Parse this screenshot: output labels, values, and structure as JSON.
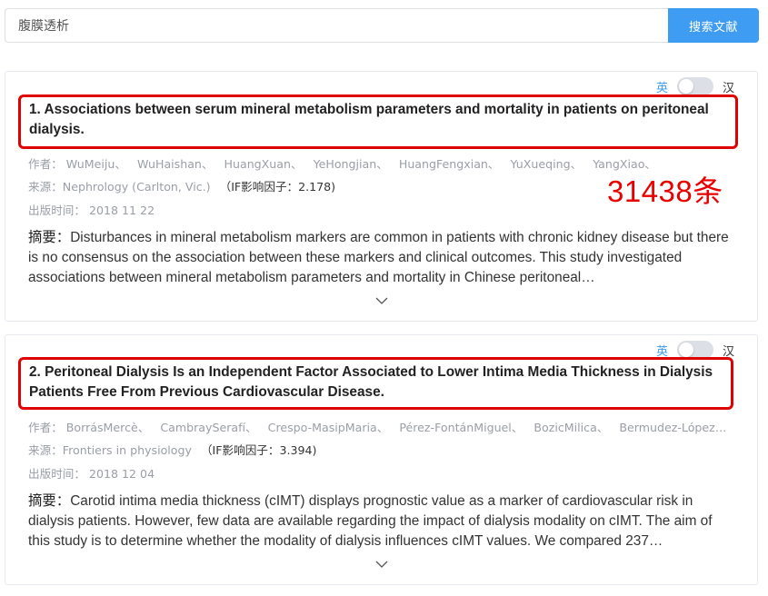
{
  "search": {
    "value": "腹膜透析",
    "button_label": "搜索文献"
  },
  "toggle": {
    "en_label": "英",
    "zh_label": "汉"
  },
  "result_count": "31438条",
  "labels": {
    "author": "作者：",
    "source": "来源：",
    "date": "出版时间：",
    "abstract": "摘要："
  },
  "articles": [
    {
      "title": "1. Associations between serum mineral metabolism parameters and mortality in patients on peritoneal dialysis.",
      "authors": [
        "WuMeiju、",
        "WuHaishan、",
        "HuangXuan、",
        "YeHongjian、",
        "HuangFengxian、",
        "YuXueqing、",
        "YangXiao、"
      ],
      "source": "Nephrology (Carlton, Vic.)",
      "impact": "（IF影响因子：2.178)",
      "date": "2018 11 22",
      "abstract": "Disturbances in mineral metabolism markers are common in patients with chronic kidney disease but there is no consensus on the association between these markers and clinical outcomes. This study investigated associations between mineral metabolism parameters and mortality in Chinese peritoneal…"
    },
    {
      "title": "2. Peritoneal Dialysis Is an Independent Factor Associated to Lower Intima Media Thickness in Dialysis Patients Free From Previous Cardiovascular Disease.",
      "authors": [
        "BorrásMercè、",
        "CambraySerafí、",
        "Crespo-MasipMaria、",
        "Pérez-FontánMiguel、",
        "BozicMilica、",
        "Bermudez-LópezMarc…"
      ],
      "source": "Frontiers in physiology",
      "impact": "（IF影响因子：3.394)",
      "date": "2018 12 04",
      "abstract": "Carotid intima media thickness (cIMT) displays prognostic value as a marker of cardiovascular risk in dialysis patients. However, few data are available regarding the impact of dialysis modality on cIMT. The aim of this study is to determine whether the modality of dialysis influences cIMT values. We compared 237…"
    }
  ]
}
